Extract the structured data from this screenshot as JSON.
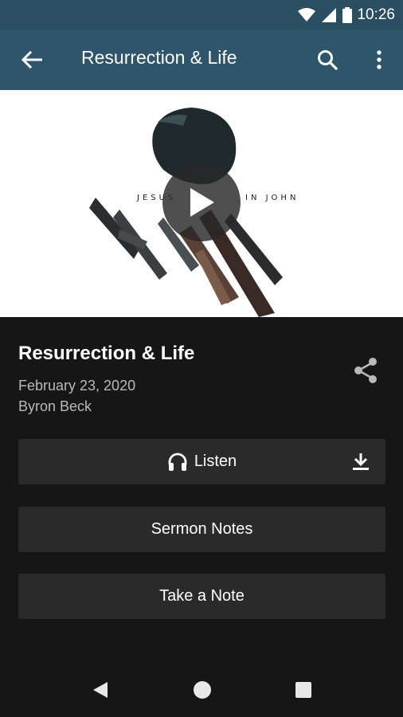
{
  "status_bar": {
    "time": "10:26"
  },
  "app_bar": {
    "title": "Resurrection & Life"
  },
  "artwork": {
    "text_left": "JESUS",
    "text_right": "IN JOHN"
  },
  "sermon": {
    "title": "Resurrection & Life",
    "date": "February 23, 2020",
    "speaker": "Byron Beck"
  },
  "buttons": {
    "listen": "Listen",
    "sermon_notes": "Sermon Notes",
    "take_note": "Take a Note"
  },
  "colors": {
    "status_bar": "#2b4f62",
    "app_bar": "#2e5569",
    "background": "#161617",
    "button": "#2a2a2b"
  },
  "icons": {
    "back": "arrow-left-icon",
    "search": "search-icon",
    "more": "more-vertical-icon",
    "play": "play-icon",
    "share": "share-icon",
    "listen": "headphones-icon",
    "download": "download-icon"
  }
}
